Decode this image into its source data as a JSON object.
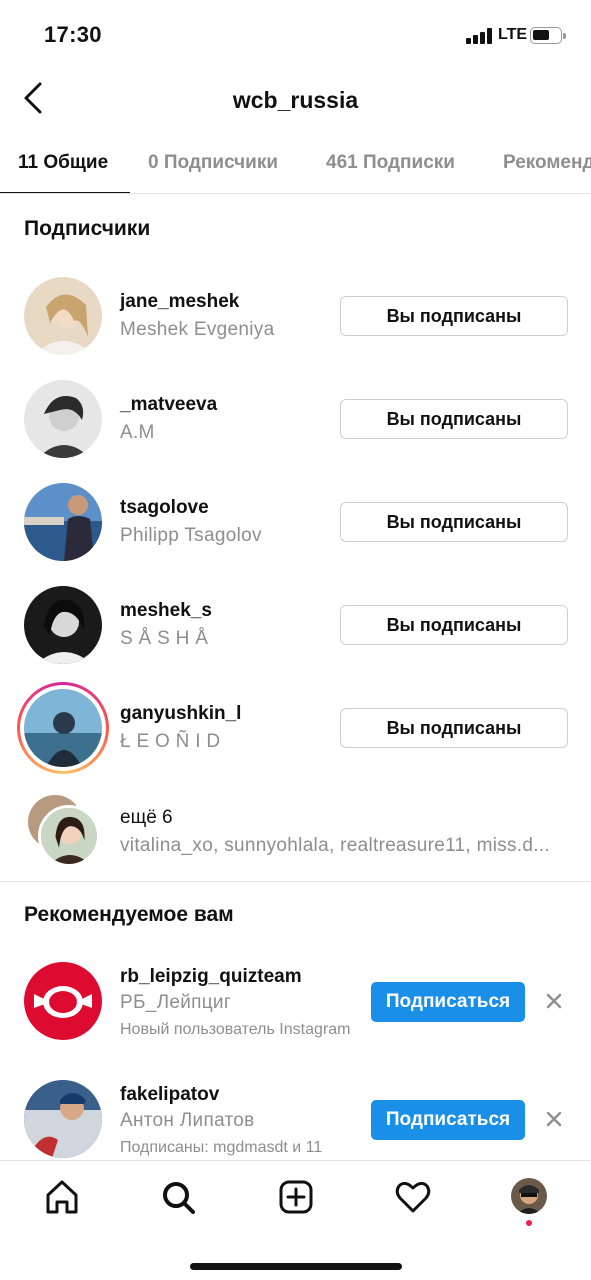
{
  "status_bar": {
    "time": "17:30",
    "network": "LTE"
  },
  "header": {
    "title": "wcb_russia"
  },
  "tabs": [
    {
      "label": "11 Общие",
      "active": true
    },
    {
      "label": "0 Подписчики",
      "active": false
    },
    {
      "label": "461 Подписки",
      "active": false
    },
    {
      "label": "Рекомендуемое",
      "active": false
    }
  ],
  "followers_section": {
    "title": "Подписчики",
    "items": [
      {
        "username": "jane_meshek",
        "name": "Meshek Evgeniya",
        "button": "Вы подписаны"
      },
      {
        "username": "_matveeva",
        "name": "A.M",
        "button": "Вы подписаны"
      },
      {
        "username": "tsagolove",
        "name": "Philipp Tsagolov",
        "button": "Вы подписаны"
      },
      {
        "username": "meshek_s",
        "name": "S Å S H Å",
        "button": "Вы подписаны"
      },
      {
        "username": "ganyushkin_l",
        "name": "Ł E O Ñ I D",
        "button": "Вы подписаны",
        "has_story": true
      }
    ],
    "more": {
      "label": "ещё 6",
      "names": "vitalina_xo, sunnyohlala, realtreasure11, miss.d..."
    }
  },
  "suggested_section": {
    "title": "Рекомендуемое вам",
    "items": [
      {
        "username": "rb_leipzig_quizteam",
        "name": "РБ_Лейпциг",
        "subtitle": "Новый пользователь Instagram",
        "button": "Подписаться"
      },
      {
        "username": "fakelipatov",
        "name": "Антон Липатов",
        "subtitle": "Подписаны: mgdmasdt и 11",
        "button": "Подписаться"
      }
    ]
  },
  "bottom_nav": [
    "home-icon",
    "search-icon",
    "new-post-icon",
    "activity-heart-icon",
    "profile-avatar"
  ],
  "colors": {
    "accent": "#1a8fe8",
    "secondary_text": "#8e8e8e",
    "notification": "#ed1f4d"
  }
}
